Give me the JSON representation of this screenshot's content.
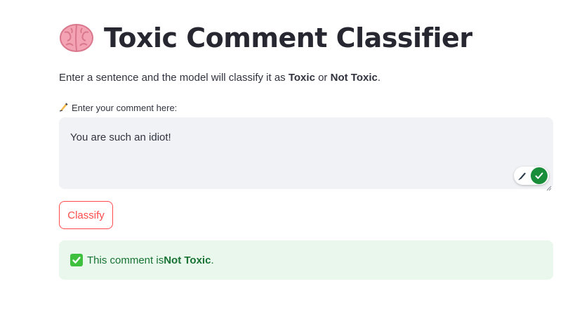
{
  "header": {
    "title_icon": "brain-emoji",
    "title": "Toxic Comment Classifier"
  },
  "description": {
    "prefix": "Enter a sentence and the model will classify it as ",
    "toxic_label": "Toxic",
    "middle": " or ",
    "not_toxic_label": "Not Toxic",
    "suffix": "."
  },
  "comment_input": {
    "label_icon": "writing-hand-emoji",
    "label": "Enter your comment here:",
    "value": "You are such an idiot!"
  },
  "grammar_widget": {
    "icons": [
      "pen-icon",
      "checkmark-icon"
    ],
    "ok_color": "#1a8d3b"
  },
  "classify_button": {
    "label": "Classify",
    "color": "#ff4b4b"
  },
  "result": {
    "icon": "white-check-mark-emoji",
    "prefix": "This comment is ",
    "verdict": "Not Toxic",
    "suffix": ".",
    "background": "#e9f7ec",
    "text_color": "#177233"
  }
}
